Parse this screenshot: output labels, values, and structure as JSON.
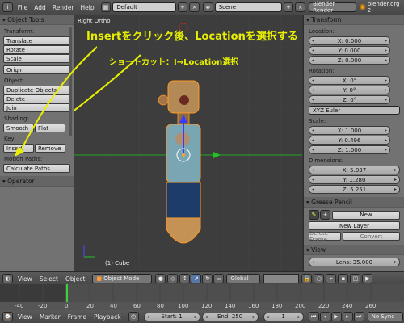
{
  "topbar": {
    "menus": [
      "File",
      "Add",
      "Render",
      "Help"
    ],
    "layout": "Default",
    "scene": "Scene",
    "engine": "Blender Render",
    "url": "blender.org 2"
  },
  "toolshelf": {
    "header": "Object Tools",
    "transform_label": "Transform:",
    "translate": "Translate",
    "rotate": "Rotate",
    "scale": "Scale",
    "origin": "Origin",
    "object_label": "Object:",
    "duplicate": "Duplicate Objects",
    "delete": "Delete",
    "join": "Join",
    "shading_label": "Shading:",
    "smooth": "Smooth",
    "flat": "Flat",
    "keyframes_label": "Key",
    "insert": "Insert",
    "remove": "Remove",
    "motion_label": "Motion Paths:",
    "calculate": "Calculate Paths",
    "operator": "Operator"
  },
  "viewport": {
    "view_name": "Right Ortho",
    "object_label": "(1) Cube"
  },
  "annotation": {
    "main": "Insertをクリック後、Locationを選択する",
    "shortcut": "ショートカット：I→Location選択"
  },
  "props": {
    "transform_header": "Transform",
    "location_label": "Location:",
    "loc_x": "X: 0.000",
    "loc_y": "Y: 0.000",
    "loc_z": "Z: 0.000",
    "rotation_label": "Rotation:",
    "rot_x": "X: 0°",
    "rot_y": "Y: 0°",
    "rot_z": "Z: 0°",
    "rot_mode": "XYZ Euler",
    "scale_label": "Scale:",
    "scale_x": "X: 1.000",
    "scale_y": "Y: 0.496",
    "scale_z": "Z: 1.000",
    "dimensions_label": "Dimensions:",
    "dim_x": "X: 5.037",
    "dim_y": "Y: 1.280",
    "dim_z": "Z: 5.251",
    "gp_header": "Grease Pencil",
    "new": "New",
    "new_layer": "New Layer",
    "delete_frame": "Delete Frame",
    "convert": "Convert",
    "view_header": "View",
    "lens": "Lens: 35.000"
  },
  "view_header": {
    "menus": [
      "View",
      "Select",
      "Object"
    ],
    "mode": "Object Mode",
    "orientation": "Global"
  },
  "timeline": {
    "ticks": [
      "-40",
      "-20",
      "0",
      "20",
      "40",
      "60",
      "80",
      "100",
      "120",
      "140",
      "160",
      "180",
      "200",
      "220",
      "240",
      "260"
    ],
    "current_frame": 1
  },
  "timeline_header": {
    "menus": [
      "View",
      "Marker",
      "Frame",
      "Playback"
    ],
    "start": "Start: 1",
    "end": "End: 250",
    "frame": "1",
    "sync": "No Sync"
  },
  "colors": {
    "annotation": "#e8f000",
    "axis_green": "#22c422",
    "axis_blue": "#3a3aff",
    "selection_orange": "#ff9b26"
  }
}
